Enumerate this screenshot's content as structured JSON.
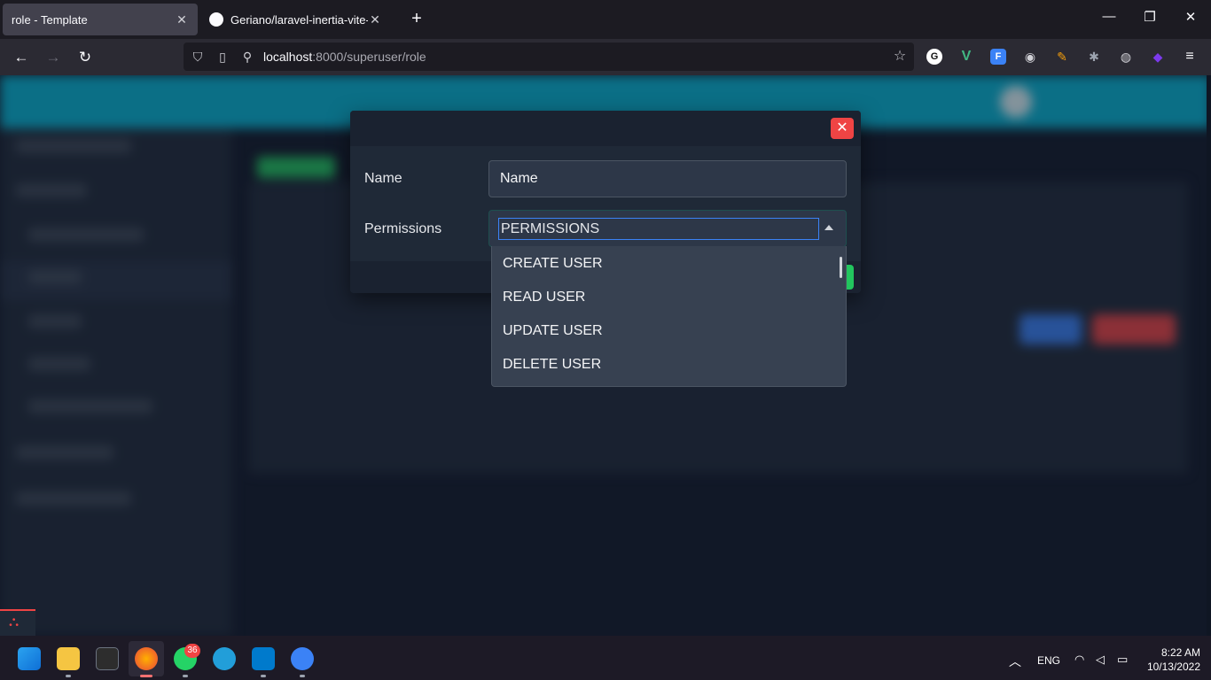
{
  "browser": {
    "tabs": [
      {
        "title": "role - Template",
        "close": "✕"
      },
      {
        "title": "Geriano/laravel-inertia-vite-tem",
        "close": "✕"
      }
    ],
    "new_tab": "+",
    "url_host": "localhost",
    "url_rest": ":8000/superuser/role"
  },
  "modal": {
    "close_label": "✕",
    "name_label": "Name",
    "name_value": "Name",
    "permissions_label": "Permissions",
    "permissions_placeholder": "PERMISSIONS",
    "options": [
      "CREATE USER",
      "READ USER",
      "UPDATE USER",
      "DELETE USER"
    ]
  },
  "taskbar": {
    "whatsapp_badge": "36",
    "language": "ENG",
    "time": "8:22 AM",
    "date": "10/13/2022"
  },
  "colors": {
    "accent": "#06b6d4",
    "danger": "#ef4444",
    "success": "#22c55e"
  }
}
